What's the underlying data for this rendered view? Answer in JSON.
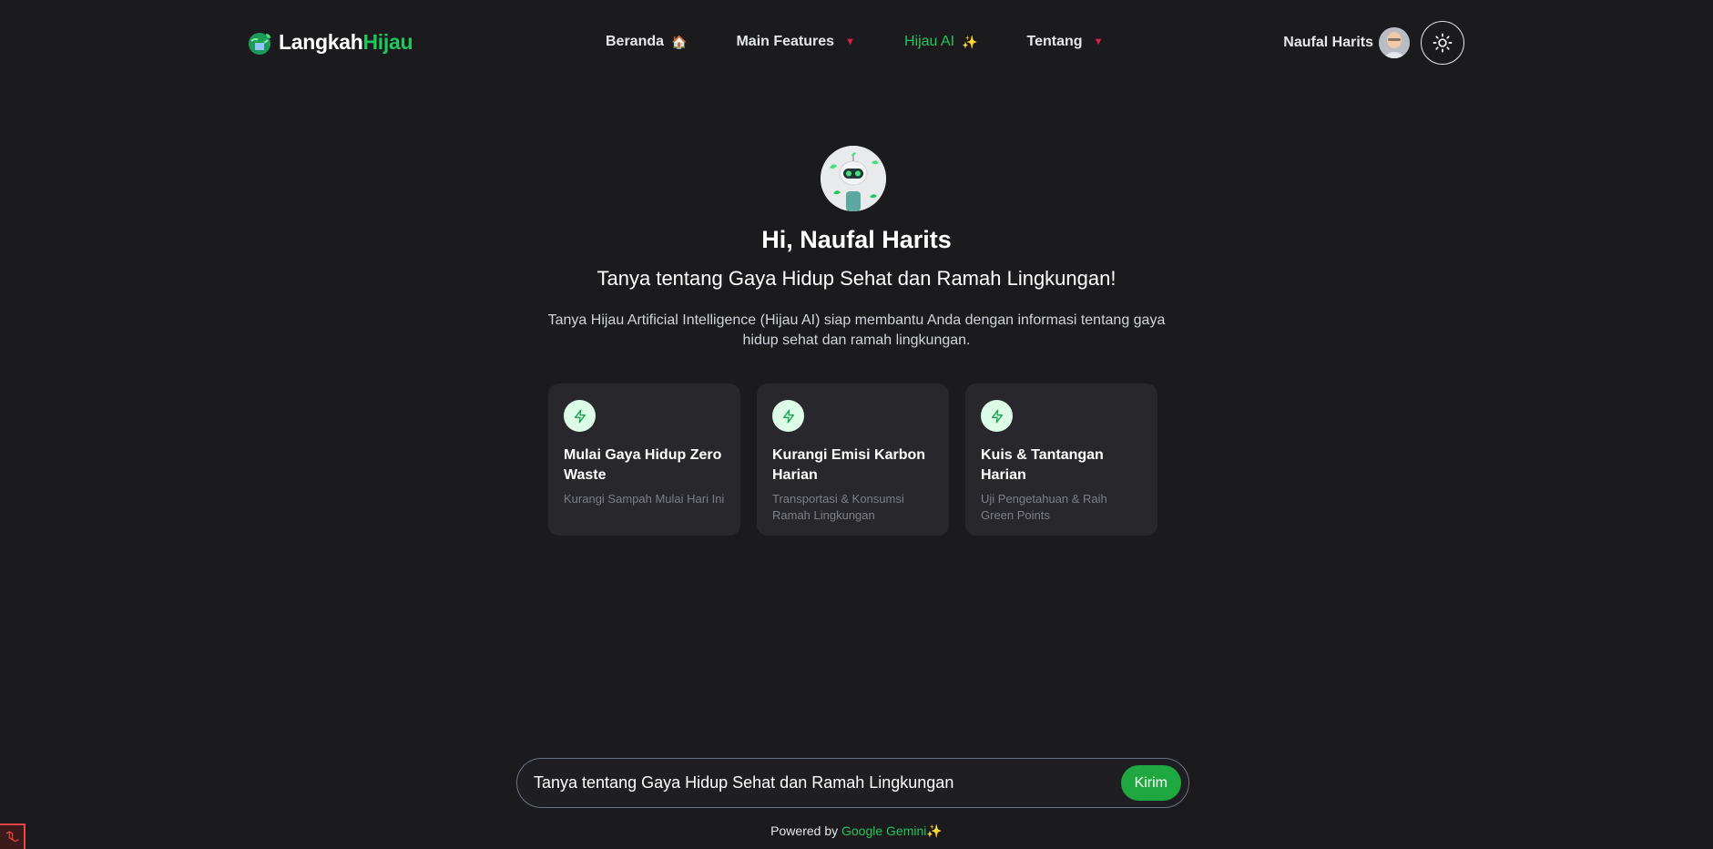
{
  "brand": {
    "part_a": "Langkah",
    "part_b": "Hijau",
    "logo_icon": "globe-leaf-icon"
  },
  "nav": {
    "items": [
      {
        "label": "Beranda",
        "emoji": "🏠"
      },
      {
        "label": "Main Features",
        "caret": "▼"
      },
      {
        "label": "Hijau AI",
        "emoji": "✨"
      },
      {
        "label": "Tentang",
        "caret": "▼"
      }
    ]
  },
  "user": {
    "name": "Naufal Harits",
    "theme_icon": "sun-icon"
  },
  "hero": {
    "greeting": "Hi, Naufal Harits",
    "subheading": "Tanya tentang Gaya Hidup Sehat dan Ramah Lingkungan!",
    "description": "Tanya Hijau Artificial Intelligence (Hijau AI) siap membantu Anda dengan informasi tentang gaya hidup sehat dan ramah lingkungan."
  },
  "cards": [
    {
      "title": "Mulai Gaya Hidup Zero Waste",
      "subtitle": "Kurangi Sampah Mulai Hari Ini",
      "icon": "lightning-icon"
    },
    {
      "title": "Kurangi Emisi Karbon Harian",
      "subtitle": "Transportasi & Konsumsi Ramah Lingkungan",
      "icon": "lightning-icon"
    },
    {
      "title": "Kuis & Tantangan Harian",
      "subtitle": "Uji Pengetahuan & Raih Green Points",
      "icon": "lightning-icon"
    }
  ],
  "chat": {
    "placeholder": "Tanya tentang Gaya Hidup Sehat dan Ramah Lingkungan",
    "send_label": "Kirim"
  },
  "footer": {
    "powered_prefix": "Powered by",
    "powered_brand": "Google Gemini",
    "powered_emoji": "✨"
  },
  "colors": {
    "accent": "#22c55e",
    "background": "#1b1a1d",
    "card": "#28272b",
    "caret": "#e11d48"
  }
}
